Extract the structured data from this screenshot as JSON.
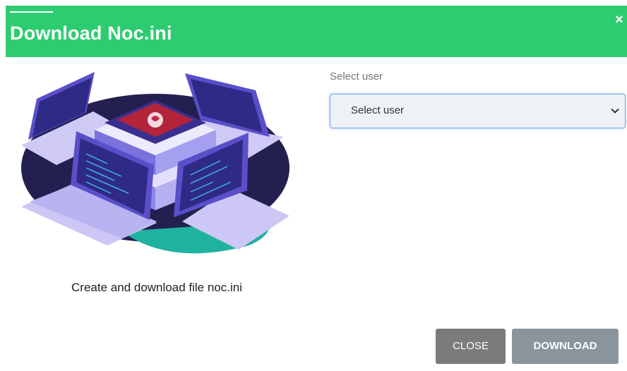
{
  "dialog": {
    "title": "Download Noc.ini",
    "close_icon": "close-icon",
    "close_glyph": "×"
  },
  "illustration": {
    "icon": "network-servers-laptops-illustration",
    "caption": "Create and download file noc.ini"
  },
  "form": {
    "user_label": "Select user",
    "user_select": {
      "selected": "Select user",
      "options": [
        "Select user"
      ]
    }
  },
  "footer": {
    "close_label": "CLOSE",
    "download_label": "DOWNLOAD"
  },
  "colors": {
    "header": "#2ecc71",
    "close_button": "#7b7b7b",
    "download_button": "#8a949c",
    "select_border": "#6ea8e8"
  }
}
